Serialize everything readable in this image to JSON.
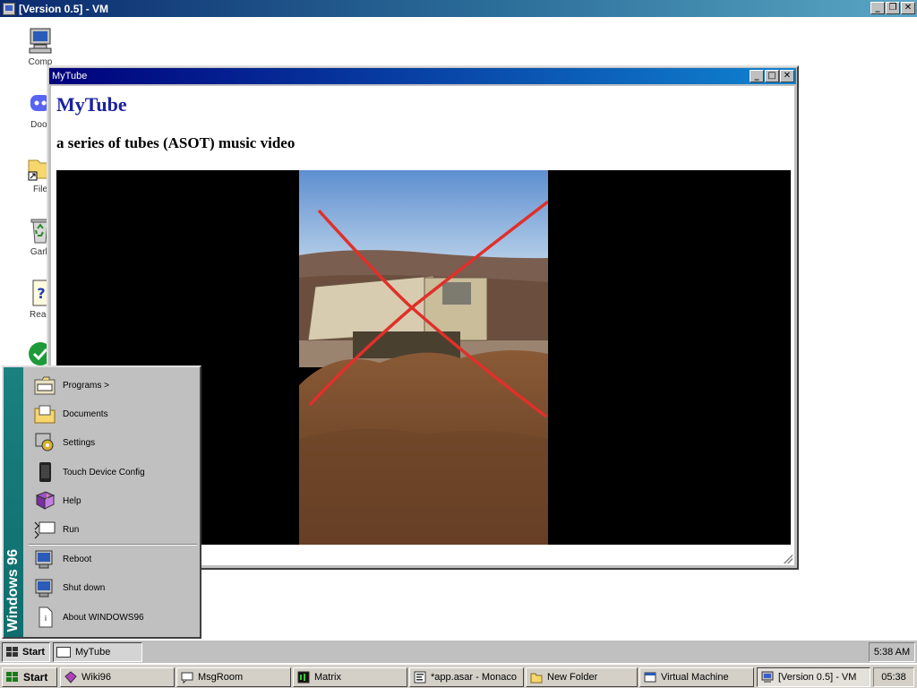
{
  "host_window": {
    "title": "[Version 0.5] - VM"
  },
  "desktop_icons": [
    {
      "label": "Comp",
      "icon": "computer-icon"
    },
    {
      "label": "Door",
      "icon": "discord-icon"
    },
    {
      "label": "File",
      "icon": "folder-shortcut-icon"
    },
    {
      "label": "Garb",
      "icon": "recycle-bin-icon"
    },
    {
      "label": "Read",
      "icon": "readme-help-icon"
    },
    {
      "label": "",
      "icon": "checkmark-icon"
    }
  ],
  "mytube_window": {
    "title": "MyTube",
    "brand": "MyTube",
    "video_title": "a series of tubes (ASOT) music video"
  },
  "start_menu": {
    "side_label": "Windows 96",
    "items": [
      {
        "label": "Programs >",
        "icon": "programs-icon"
      },
      {
        "label": "Documents",
        "icon": "documents-folder-icon"
      },
      {
        "label": "Settings",
        "icon": "settings-icon"
      },
      {
        "label": "Touch Device Config",
        "icon": "touch-device-icon"
      },
      {
        "label": "Help",
        "icon": "help-book-icon"
      },
      {
        "label": "Run",
        "icon": "run-icon"
      },
      {
        "label": "Reboot",
        "icon": "reboot-icon"
      },
      {
        "label": "Shut down",
        "icon": "shutdown-icon"
      },
      {
        "label": "About WINDOWS96",
        "icon": "about-icon"
      }
    ]
  },
  "inner_taskbar": {
    "start_label": "Start",
    "tasks": [
      {
        "label": "MyTube"
      }
    ],
    "clock": "5:38 AM"
  },
  "host_taskbar": {
    "start_label": "Start",
    "tasks": [
      {
        "label": "Wiki96"
      },
      {
        "label": "MsgRoom"
      },
      {
        "label": "Matrix"
      },
      {
        "label": "*app.asar - Monaco"
      },
      {
        "label": "New Folder"
      },
      {
        "label": "Virtual Machine"
      },
      {
        "label": "[Version 0.5] - VM"
      }
    ],
    "clock": "05:38"
  },
  "colors": {
    "accent": "#1a22a0",
    "start_menu_side": "#1a8080",
    "title_active": "#00007b"
  }
}
